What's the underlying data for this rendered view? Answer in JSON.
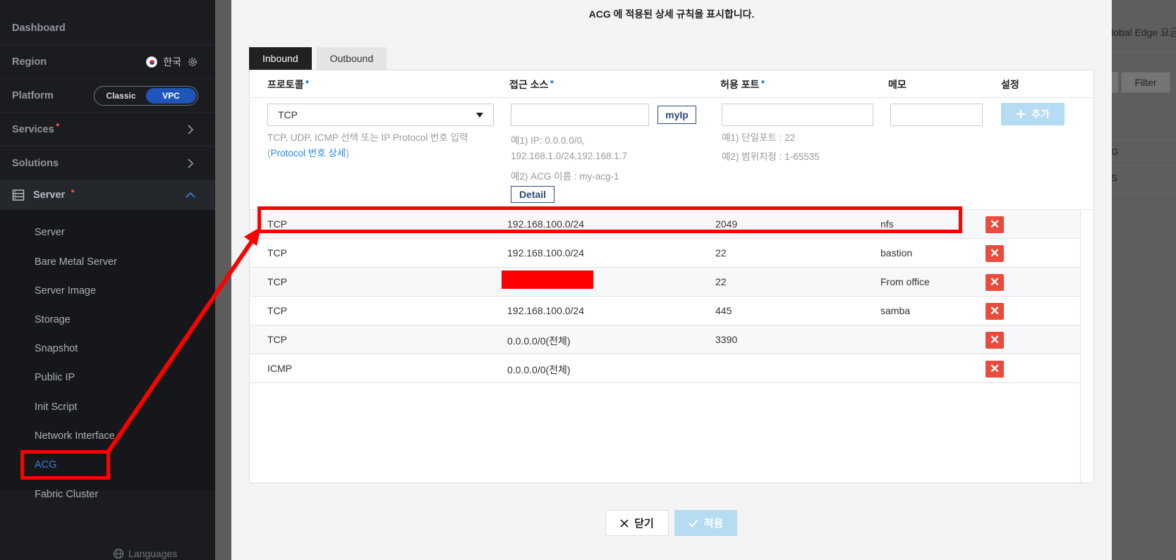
{
  "sidebar": {
    "dashboard": "Dashboard",
    "region": "Region",
    "region_value": "한국",
    "platform": "Platform",
    "platform_options": [
      "Classic",
      "VPC"
    ],
    "services": "Services",
    "solutions": "Solutions",
    "server_group": "Server",
    "server_items": [
      "Server",
      "Bare Metal Server",
      "Server Image",
      "Storage",
      "Snapshot",
      "Public IP",
      "Init Script",
      "Network Interface",
      "ACG",
      "Fabric Cluster"
    ],
    "active_item": "ACG",
    "languages": "Languages"
  },
  "background": {
    "global_edge_text": "lobal Edge 요금",
    "filter_label": "Filter",
    "row_letters": [
      "G",
      "S"
    ]
  },
  "modal": {
    "description": "ACG 에 적용된 상세 규칙을 표시합니다.",
    "tabs": [
      "Inbound",
      "Outbound"
    ],
    "active_tab": "Inbound",
    "columns": {
      "protocol": "프로토콜",
      "source": "접근 소스",
      "port": "허용 포트",
      "memo": "메모",
      "settings": "설정"
    },
    "form": {
      "protocol_value": "TCP",
      "source_value": "",
      "port_value": "",
      "memo_value": "",
      "myip_label": "myIp",
      "add_label": "추가",
      "protocol_help": "TCP, UDP, ICMP 선택 또는 IP Protocol 번호 입력",
      "protocol_help_open": "(",
      "protocol_link": "Protocol 번호 상세",
      "protocol_help_close": ")",
      "source_help_1": "예1) IP: 0.0.0.0/0,",
      "source_help_2": "192.168.1.0/24,192.168.1.7",
      "source_help_3": "예2) ACG 이름 : my-acg-1",
      "detail_label": "Detail",
      "port_help_1": "예1) 단일포트 : 22",
      "port_help_2": "예2) 범위지정 : 1-65535"
    },
    "rules": [
      {
        "protocol": "TCP",
        "source": "192.168.100.0/24",
        "port": "2049",
        "memo": "nfs"
      },
      {
        "protocol": "TCP",
        "source": "192.168.100.0/24",
        "port": "22",
        "memo": "bastion"
      },
      {
        "protocol": "TCP",
        "source": "",
        "port": "22",
        "memo": "From office"
      },
      {
        "protocol": "TCP",
        "source": "192.168.100.0/24",
        "port": "445",
        "memo": "samba"
      },
      {
        "protocol": "TCP",
        "source": "0.0.0.0/0(전체)",
        "port": "3390",
        "memo": ""
      },
      {
        "protocol": "ICMP",
        "source": "0.0.0.0/0(전체)",
        "port": "",
        "memo": ""
      }
    ],
    "delete_glyph": "✕",
    "close_label": "닫기",
    "apply_label": "적용"
  },
  "colors": {
    "annotation_red": "#ff0000",
    "delete_red": "#e94c3d",
    "vpc_blue": "#1e55b8",
    "disabled_blue": "#b5dcf2"
  }
}
